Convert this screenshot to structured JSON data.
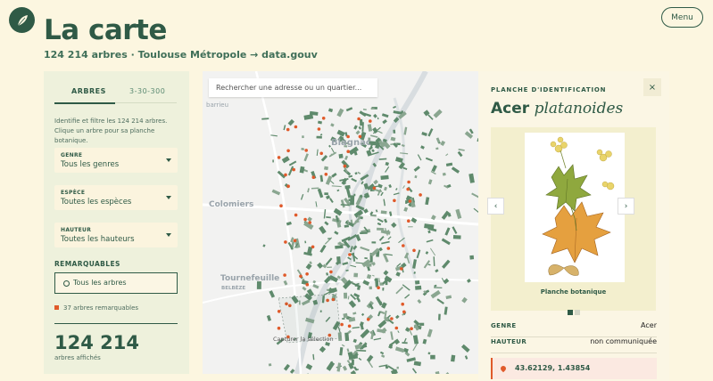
{
  "header": {
    "title": "La carte",
    "subtitle": "124 214 arbres · Toulouse Métropole → data.gouv",
    "menu_label": "Menu"
  },
  "sidebar": {
    "tabs": [
      {
        "label": "ARBRES",
        "active": true
      },
      {
        "label": "3-30-300",
        "active": false
      }
    ],
    "intro": "Identifie et filtre les 124 214 arbres. Clique un arbre pour sa planche botanique.",
    "filters": [
      {
        "label": "GENRE",
        "value": "Tous les genres"
      },
      {
        "label": "ESPÈCE",
        "value": "Toutes les espèces"
      },
      {
        "label": "HAUTEUR",
        "value": "Toutes les hauteurs"
      }
    ],
    "remarquables_heading": "REMARQUABLES",
    "all_trees_label": "Tous les arbres",
    "remarquables_count": "37 arbres remarquables",
    "count": "124 214",
    "count_label": "arbres affichés"
  },
  "map": {
    "search_placeholder": "Rechercher une adresse ou un quartier...",
    "labels": [
      "Blagnac",
      "Colomiers",
      "Tournefeuille",
      "BELBÈZE",
      "barrieu"
    ],
    "capture_label": "Capturer la sélection"
  },
  "panel": {
    "heading": "PLANCHE D'IDENTIFICATION",
    "close_label": "×",
    "genus": "Acer",
    "species": "platanoides",
    "caption": "Planche botanique",
    "prev": "‹",
    "next": "›",
    "details": [
      {
        "key": "GENRE",
        "value": "Acer"
      },
      {
        "key": "HAUTEUR",
        "value": "non communiquée"
      }
    ],
    "coords": "43.62129, 1.43854"
  },
  "colors": {
    "primary": "#2f5a46",
    "background": "#fcf6e0",
    "accent": "#e05a2a"
  }
}
